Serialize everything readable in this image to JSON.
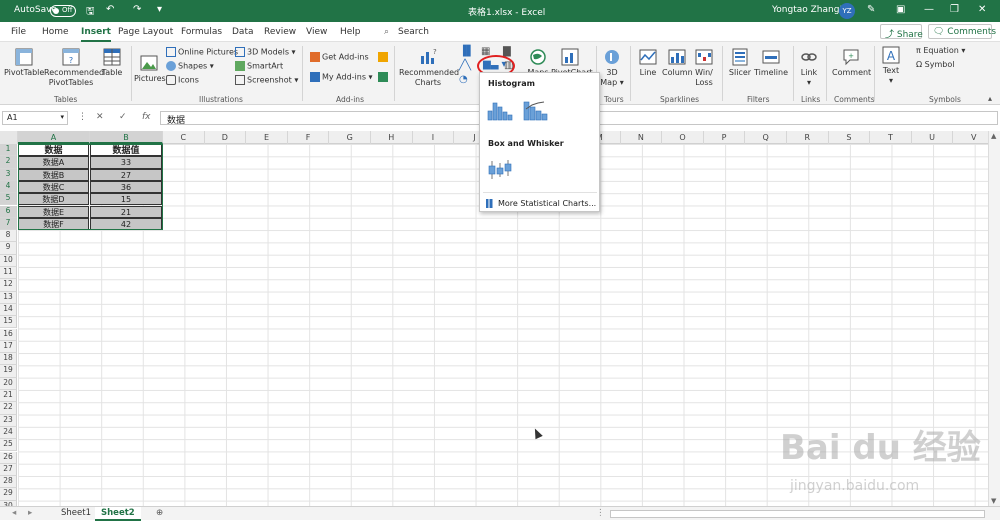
{
  "titlebar": {
    "autosave": "AutoSave",
    "toggle": "Off",
    "filename": "表格1.xlsx  -  Excel",
    "search": "Search",
    "user": "Yongtao Zhang3",
    "initials": "YZ"
  },
  "menu": [
    "File",
    "Home",
    "Insert",
    "Page Layout",
    "Formulas",
    "Data",
    "Review",
    "View",
    "Help"
  ],
  "menu_active": "Insert",
  "share": "Share",
  "comments": "Comments",
  "ribbon": {
    "pivottable": "PivotTable",
    "rec_pivot": "Recommended",
    "rec_pivot2": "PivotTables",
    "table": "Table",
    "pictures": "Pictures",
    "online_pictures": "Online Pictures",
    "shapes": "Shapes",
    "icons": "Icons",
    "models3d": "3D Models",
    "smartart": "SmartArt",
    "screenshot": "Screenshot",
    "get_addins": "Get Add-ins",
    "my_addins": "My Add-ins",
    "rec_charts": "Recommended",
    "rec_charts2": "Charts",
    "maps": "Maps",
    "pivotchart": "PivotChart",
    "map3d": "3D",
    "map3d2": "Map",
    "line": "Line",
    "column": "Column",
    "winloss": "Win/",
    "winloss2": "Loss",
    "slicer": "Slicer",
    "timeline": "Timeline",
    "link": "Link",
    "comment": "Comment",
    "text": "Text",
    "equation": "Equation",
    "symbol": "Symbol",
    "groups": {
      "tables": "Tables",
      "illustrations": "Illustrations",
      "addins": "Add-ins",
      "tours": "Tours",
      "sparklines": "Sparklines",
      "filters": "Filters",
      "links": "Links",
      "comments": "Comments",
      "symbols": "Symbols"
    }
  },
  "formula": {
    "namebox": "A1",
    "value": "数据"
  },
  "columns": [
    "A",
    "B",
    "C",
    "D",
    "E",
    "F",
    "G",
    "H",
    "I",
    "J",
    "K",
    "L",
    "M",
    "N",
    "O",
    "P",
    "Q",
    "R",
    "S",
    "T",
    "U",
    "V"
  ],
  "rows": [
    "1",
    "2",
    "3",
    "4",
    "5",
    "6",
    "7",
    "8",
    "9",
    "10",
    "11",
    "12",
    "13",
    "14",
    "15",
    "16",
    "17",
    "18",
    "19",
    "20",
    "21",
    "22",
    "23",
    "24",
    "25",
    "26",
    "27",
    "28",
    "29",
    "30"
  ],
  "table": {
    "headers": [
      "数据",
      "数据值"
    ],
    "rows": [
      [
        "数据A",
        "33"
      ],
      [
        "数据B",
        "27"
      ],
      [
        "数据C",
        "36"
      ],
      [
        "数据D",
        "15"
      ],
      [
        "数据E",
        "21"
      ],
      [
        "数据F",
        "42"
      ]
    ]
  },
  "dropdown": {
    "histogram": "Histogram",
    "box_whisker": "Box and Whisker",
    "more": "More Statistical Charts..."
  },
  "sheets": [
    "Sheet1",
    "Sheet2"
  ],
  "active_sheet": "Sheet2",
  "watermark": "Bai du 经验",
  "watermark_url": "jingyan.baidu.com",
  "colors": {
    "excel_green": "#217346",
    "highlight_red": "#e02020",
    "cell_gray": "#c6c6c6"
  }
}
